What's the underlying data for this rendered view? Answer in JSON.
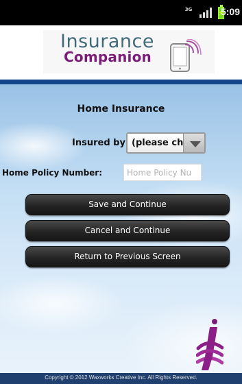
{
  "status_bar": {
    "network_label": "3G",
    "signal_icon": "signal-icon",
    "battery_icon": "battery-charging-icon",
    "time": "5:09"
  },
  "header": {
    "logo_title": "Insurance",
    "logo_subtitle": "Companion",
    "logo_icon": "phone-icon"
  },
  "page": {
    "title": "Home Insurance",
    "insured_label": "Insured by:",
    "insured_selected": "(please ch",
    "policy_label": "Home Policy Number:",
    "policy_placeholder": "Home Policy Nu",
    "policy_value": ""
  },
  "buttons": {
    "save": "Save and Continue",
    "cancel": "Cancel and Continue",
    "return": "Return to Previous Screen"
  },
  "footer": {
    "copyright": "Copyright © 2012 Waxworks Creative Inc. All Rights Reserved."
  },
  "colors": {
    "status_background": "#000000",
    "header_background": "#ffffff",
    "accent_blue": "#15448a",
    "logo_blue": "#416b78",
    "logo_purple": "#7b1c79",
    "button_dark": "#242424",
    "footer_blue": "#20406f"
  }
}
